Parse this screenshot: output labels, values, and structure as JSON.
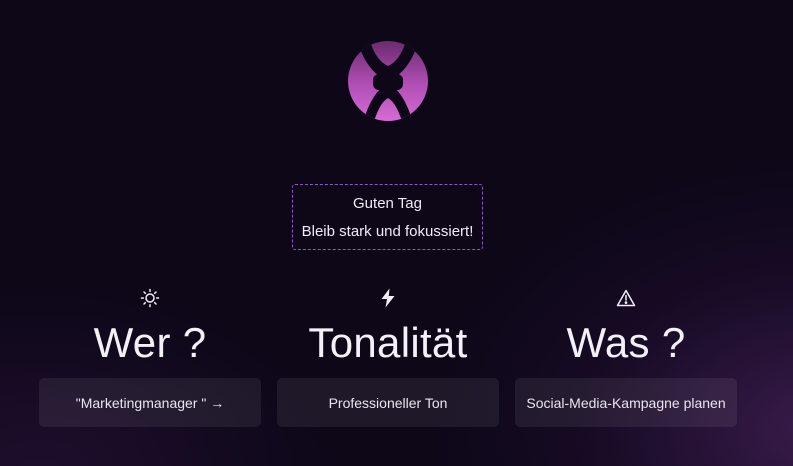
{
  "greeting": {
    "title": "Guten Tag",
    "message": "Bleib stark und fokussiert!"
  },
  "columns": [
    {
      "icon": "sun-icon",
      "title": "Wer ?",
      "chip": "\"Marketingmanager \" →"
    },
    {
      "icon": "lightning-icon",
      "title": "Tonalität",
      "chip": "Professioneller Ton"
    },
    {
      "icon": "warning-icon",
      "title": "Was ?",
      "chip": "Social-Media-Kampagne planen"
    }
  ],
  "colors": {
    "background": "#0d0718",
    "accent_purple": "#b04fb4",
    "border_purple": "#8a5bc0",
    "chip_bg": "rgba(255,255,255,0.07)"
  }
}
